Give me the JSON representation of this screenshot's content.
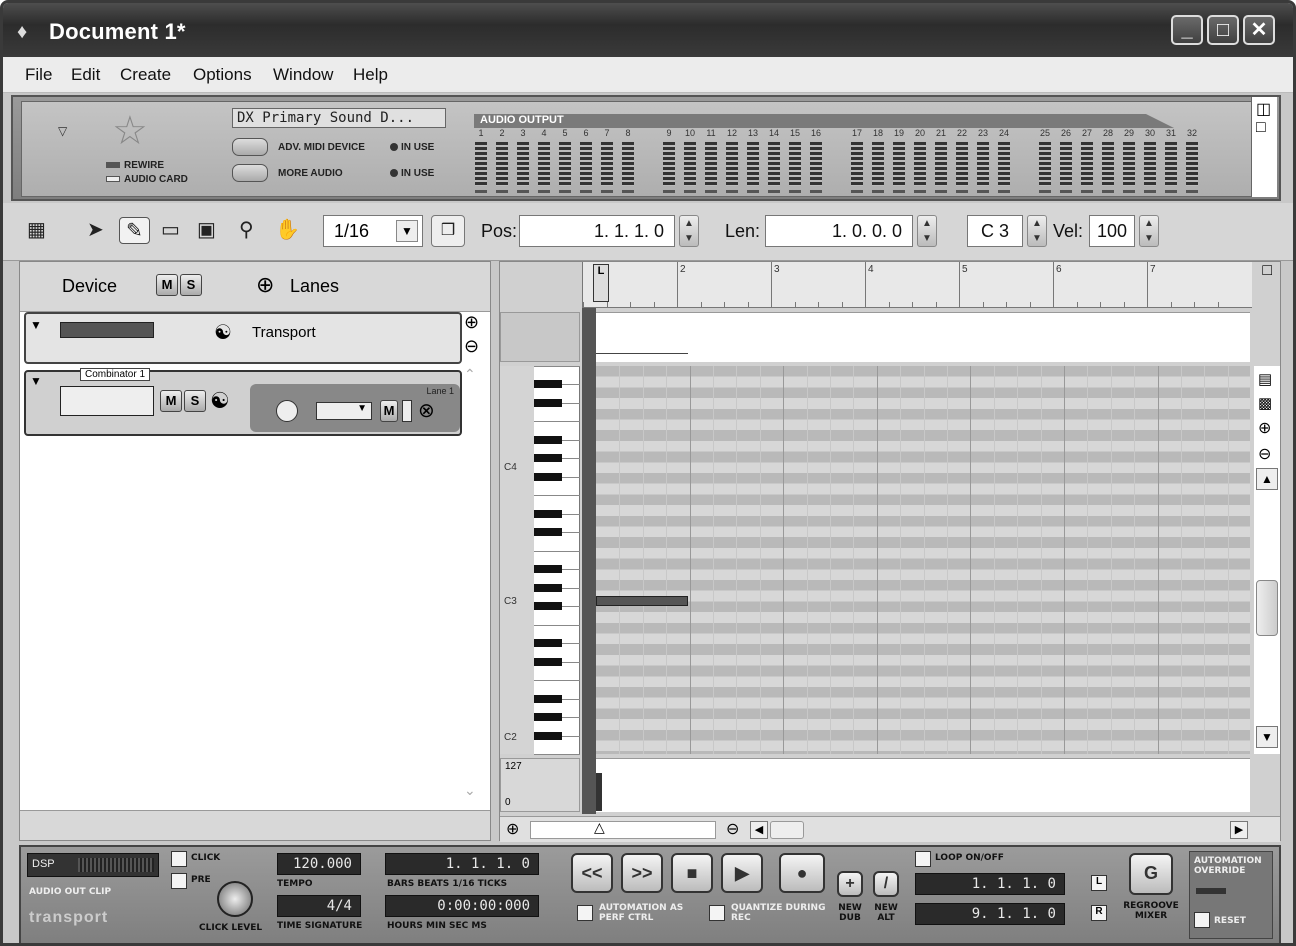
{
  "window": {
    "title": "Document 1*"
  },
  "menu": [
    "File",
    "Edit",
    "Create",
    "Options",
    "Window",
    "Help"
  ],
  "rack": {
    "device_name": "DX Primary Sound D...",
    "rewire_label": "REWIRE",
    "audio_card_label": "AUDIO CARD",
    "adv_midi_label": "ADV. MIDI DEVICE",
    "more_audio_label": "MORE AUDIO",
    "in_use_1": "IN USE",
    "in_use_2": "IN USE",
    "audio_output_label": "AUDIO OUTPUT",
    "channels": [
      "1",
      "2",
      "3",
      "4",
      "5",
      "6",
      "7",
      "8",
      "9",
      "10",
      "11",
      "12",
      "13",
      "14",
      "15",
      "16",
      "17",
      "18",
      "19",
      "20",
      "21",
      "22",
      "23",
      "24",
      "25",
      "26",
      "27",
      "28",
      "29",
      "30",
      "31",
      "32"
    ]
  },
  "toolbar": {
    "snap_value": "1/16",
    "pos_label": "Pos:",
    "pos_value": "1. 1. 1.   0",
    "len_label": "Len:",
    "len_value": "1. 0. 0.   0",
    "note_value": "C 3",
    "vel_label": "Vel:",
    "vel_value": "100"
  },
  "tracklist": {
    "device_header": "Device",
    "m_label": "M",
    "s_label": "S",
    "lanes_label": "Lanes",
    "transport_track": "Transport",
    "combinator_name": "Combinator 1",
    "lane_label": "Lane 1"
  },
  "editor": {
    "bars": [
      "2",
      "3",
      "4",
      "5",
      "6",
      "7"
    ],
    "loop_marker": "L",
    "octave_labels": [
      "C4",
      "C3",
      "C2"
    ],
    "velocity_max": "127",
    "velocity_min": "0"
  },
  "transport": {
    "dsp_label": "DSP",
    "audio_clip_label": "AUDIO OUT CLIP",
    "brand": "transport",
    "click_label": "CLICK",
    "pre_label": "PRE",
    "click_level_label": "CLICK LEVEL",
    "tempo_value": "120.000",
    "tempo_label": "TEMPO",
    "time_sig_value": "4/4",
    "time_sig_label": "TIME SIGNATURE",
    "position_bars": "1.  1.  1.   0",
    "position_bars_label": "BARS  BEATS  1/16  TICKS",
    "position_time": "0:00:00:000",
    "position_time_label": "HOURS   MIN   SEC     MS",
    "rewind_label": "<<",
    "ffwd_label": ">>",
    "auto_perf_label": "AUTOMATION AS PERF CTRL",
    "quantize_label": "QUANTIZE DURING REC",
    "new_dub_label": "NEW DUB",
    "new_alt_label": "NEW ALT",
    "loop_label": "LOOP ON/OFF",
    "loop_left": "1.  1.  1.   0",
    "loop_right": "9.  1.  1.   0",
    "loop_left_btn": "L",
    "loop_right_btn": "R",
    "regroove_label": "REGROOVE MIXER",
    "auto_override_label": "AUTOMATION OVERRIDE",
    "reset_label": "RESET"
  }
}
